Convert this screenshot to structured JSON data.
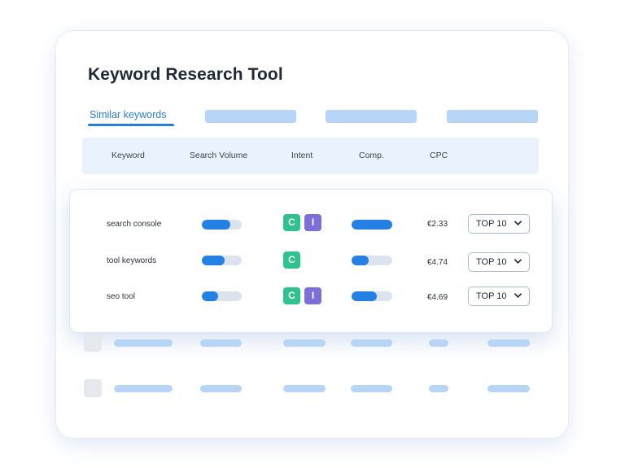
{
  "app": {
    "title": "Keyword Research Tool"
  },
  "tabs": {
    "active_label": "Similar keywords"
  },
  "table": {
    "columns": [
      "Keyword",
      "Search Volume",
      "Intent",
      "Comp.",
      "CPC"
    ],
    "rows": [
      {
        "keyword": "search console",
        "search_volume_fraction": 0.72,
        "intent": [
          "C",
          "I"
        ],
        "comp_fraction": 1.0,
        "cpc": "€2.33",
        "rank_select": "TOP 10"
      },
      {
        "keyword": "tool keywords",
        "search_volume_fraction": 0.58,
        "intent": [
          "C"
        ],
        "comp_fraction": 0.42,
        "cpc": "€4.74",
        "rank_select": "TOP 10"
      },
      {
        "keyword": "seo tool",
        "search_volume_fraction": 0.4,
        "intent": [
          "C",
          "I"
        ],
        "comp_fraction": 0.62,
        "cpc": "€4.69",
        "rank_select": "TOP 10"
      }
    ]
  },
  "colors": {
    "accent": "#2b7cd9",
    "bar_fill": "#2580e3",
    "intent_commercial": "#2fc28f",
    "intent_informational": "#7c6fd8",
    "placeholder": "#b7d6f7"
  },
  "icons": {
    "dropdown": "chevron-down-icon"
  }
}
